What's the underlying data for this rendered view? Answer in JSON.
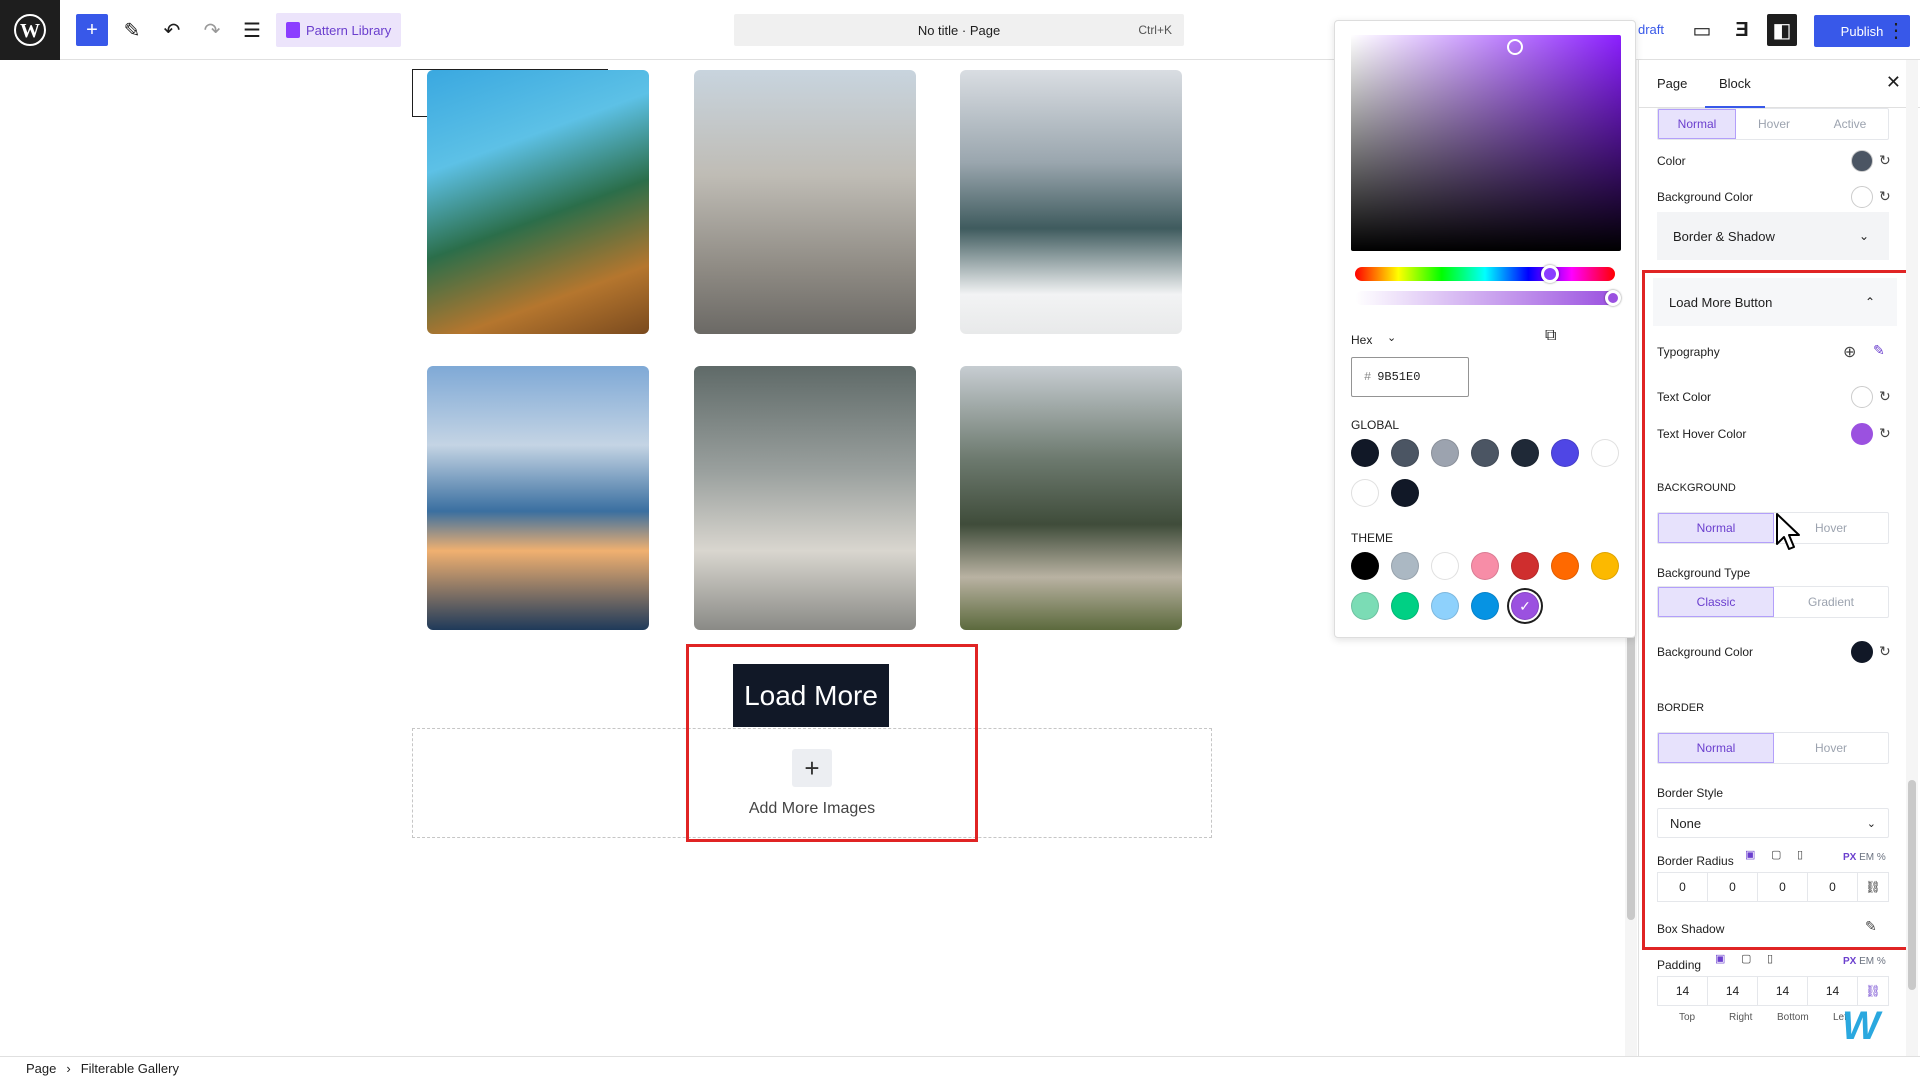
{
  "topbar": {
    "pattern_library": "Pattern Library",
    "doc_title": "No title · Page",
    "shortcut": "Ctrl+K",
    "draft": "draft",
    "publish": "Publish"
  },
  "canvas": {
    "load_more": "Load More",
    "add_more_images": "Add More Images"
  },
  "footer": {
    "crumb_root": "Page",
    "crumb_sep": "›",
    "crumb_current": "Filterable Gallery"
  },
  "picker": {
    "hex_label": "Hex",
    "hex_value": "9B51E0",
    "hash": "#",
    "global_label": "GLOBAL",
    "theme_label": "THEME",
    "global_colors": [
      "#111827",
      "#4b5563",
      "#9ca3af",
      "#4b5563",
      "#1f2937",
      "#4f46e5",
      "#ffffff",
      "#ffffff",
      "#111827"
    ],
    "theme_colors": [
      "#000000",
      "#abb8c3",
      "#ffffff",
      "#f78da7",
      "#cf2e2e",
      "#ff6900",
      "#fcb900",
      "#7bdcb5",
      "#00d084",
      "#8ed1fc",
      "#0693e3",
      "#9b51e0"
    ],
    "selected_color": "#9b51e0"
  },
  "sidebar": {
    "tab_page": "Page",
    "tab_block": "Block",
    "state_tabs": [
      "Normal",
      "Hover",
      "Active"
    ],
    "color_label": "Color",
    "bg_color_label": "Background Color",
    "border_shadow": "Border & Shadow",
    "load_more_button": "Load More Button",
    "typography": "Typography",
    "text_color": "Text Color",
    "text_hover_color": "Text Hover Color",
    "background_head": "BACKGROUND",
    "bg_tabs": [
      "Normal",
      "Hover"
    ],
    "bg_type_label": "Background Type",
    "bg_type_tabs": [
      "Classic",
      "Gradient"
    ],
    "bg_color2_label": "Background Color",
    "border_head": "BORDER",
    "border_tabs": [
      "Normal",
      "Hover"
    ],
    "border_style_label": "Border Style",
    "border_style_value": "None",
    "border_radius_label": "Border Radius",
    "radius_values": [
      "0",
      "0",
      "0",
      "0"
    ],
    "box_shadow": "Box Shadow",
    "padding_label": "Padding",
    "padding_values": [
      "14",
      "14",
      "14",
      "14"
    ],
    "padding_sides": [
      "Top",
      "Right",
      "Bottom",
      "Left"
    ],
    "units": [
      "PX",
      "EM",
      "%"
    ],
    "colors": {
      "color_swatch": "#4b5563",
      "text_hover_swatch": "#9b51e0",
      "bg_color_swatch": "#111827"
    }
  },
  "icons": {
    "wp": "wordpress-logo-icon",
    "add": "plus-icon",
    "pencil": "pencil-icon",
    "undo": "undo-icon",
    "redo": "redo-icon",
    "outline": "list-view-icon",
    "view": "desktop-view-icon",
    "settings": "settings-sidebar-icon",
    "more": "more-vertical-icon"
  }
}
